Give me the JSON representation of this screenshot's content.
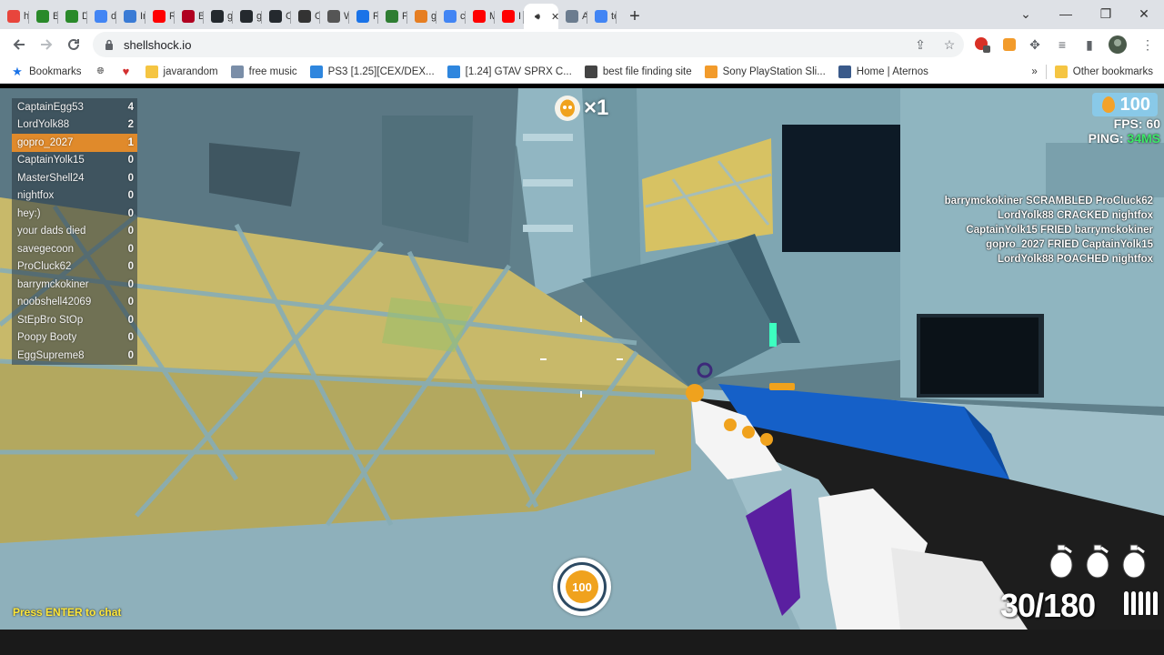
{
  "browser": {
    "tabs": [
      {
        "label": "hc",
        "icon": "multicolor-icon",
        "color": "#e8453c"
      },
      {
        "label": "Bu",
        "icon": "green-app-icon",
        "color": "#2a8a2a"
      },
      {
        "label": "Dc",
        "icon": "green-app-icon",
        "color": "#2a8a2a"
      },
      {
        "label": "de",
        "icon": "google-icon",
        "color": "#4285f4"
      },
      {
        "label": "Im",
        "icon": "chart-icon",
        "color": "#3a7bd5"
      },
      {
        "label": "Ru",
        "icon": "youtube-icon",
        "color": "#ff0000"
      },
      {
        "label": "Be",
        "icon": "m-icon",
        "color": "#b00020"
      },
      {
        "label": "gc",
        "icon": "github-icon",
        "color": "#24292e"
      },
      {
        "label": "gc",
        "icon": "github-icon",
        "color": "#24292e"
      },
      {
        "label": "Cl",
        "icon": "github-icon",
        "color": "#24292e"
      },
      {
        "label": "Oj",
        "icon": "openai-icon",
        "color": "#333333"
      },
      {
        "label": "W",
        "icon": "globe-icon",
        "color": "#555555"
      },
      {
        "label": "Re",
        "icon": "blue-dot-icon",
        "color": "#1a73e8"
      },
      {
        "label": "Py",
        "icon": "w-icon",
        "color": "#2e7d32"
      },
      {
        "label": "gi",
        "icon": "orange-icon",
        "color": "#e67e22"
      },
      {
        "label": "ca",
        "icon": "google-icon",
        "color": "#4285f4"
      },
      {
        "label": "M",
        "icon": "youtube-icon",
        "color": "#ff0000"
      },
      {
        "label": "I t",
        "icon": "youtube-icon",
        "color": "#ff0000"
      },
      {
        "label": "",
        "icon": "speaker-icon",
        "color": "#333333",
        "active": true
      },
      {
        "label": "A",
        "icon": "avatar-icon",
        "color": "#6b7c8f"
      },
      {
        "label": "te",
        "icon": "google-icon",
        "color": "#4285f4"
      }
    ],
    "active_tab_close": "✕",
    "new_tab": "+",
    "url": "shellshock.io",
    "bookmarks_label": "Bookmarks",
    "bookmarks": [
      {
        "label": "javarandom",
        "icon": "folder-icon"
      },
      {
        "label": "free music",
        "icon": "music-icon"
      },
      {
        "label": "PS3 [1.25][CEX/DEX...",
        "icon": "e-icon"
      },
      {
        "label": "[1.24] GTAV SPRX C...",
        "icon": "e-icon"
      },
      {
        "label": "best file finding site",
        "icon": "robot-icon"
      },
      {
        "label": "Sony PlayStation Sli...",
        "icon": "bag-icon"
      },
      {
        "label": "Home | Aternos",
        "icon": "grid-icon"
      }
    ],
    "more_bookmarks": "»",
    "other_bookmarks": "Other bookmarks"
  },
  "game": {
    "scoreboard": [
      {
        "name": "CaptainEgg53",
        "score": "4"
      },
      {
        "name": "LordYolk88",
        "score": "2"
      },
      {
        "name": "gopro_2027",
        "score": "1",
        "me": true
      },
      {
        "name": "CaptainYolk15",
        "score": "0"
      },
      {
        "name": "MasterShell24",
        "score": "0"
      },
      {
        "name": "nightfox",
        "score": "0"
      },
      {
        "name": "hey:)",
        "score": "0"
      },
      {
        "name": "your dads died",
        "score": "0"
      },
      {
        "name": "savegecoon",
        "score": "0"
      },
      {
        "name": "ProCluck62",
        "score": "0"
      },
      {
        "name": "barrymckokiner",
        "score": "0"
      },
      {
        "name": "noobshell42069",
        "score": "0"
      },
      {
        "name": "StEpBro StOp",
        "score": "0"
      },
      {
        "name": "Poopy Booty",
        "score": "0"
      },
      {
        "name": "EggSupreme8",
        "score": "0"
      }
    ],
    "kill_multiplier": "×1",
    "eggs": "100",
    "fps_label": "FPS:",
    "fps_value": "60",
    "ping_label": "PING:",
    "ping_value": "34MS",
    "killfeed": [
      "barrymckokiner SCRAMBLED ProCluck62",
      "LordYolk88 CRACKED nightfox",
      "CaptainYolk15 FRIED barrymckokiner",
      "gopro_2027 FRIED CaptainYolk15",
      "LordYolk88 POACHED nightfox"
    ],
    "health": "100",
    "chat_prompt": "Press ENTER to chat",
    "ammo": "30/180",
    "grenade_count": 3,
    "colors": {
      "me_row": "#e08a2b",
      "ping_good": "#3ee86a",
      "chat_prompt": "#ffe83a",
      "health_core": "#f0a21d",
      "gun_blue": "#1560c8",
      "gun_purple": "#5a1fa0"
    }
  }
}
